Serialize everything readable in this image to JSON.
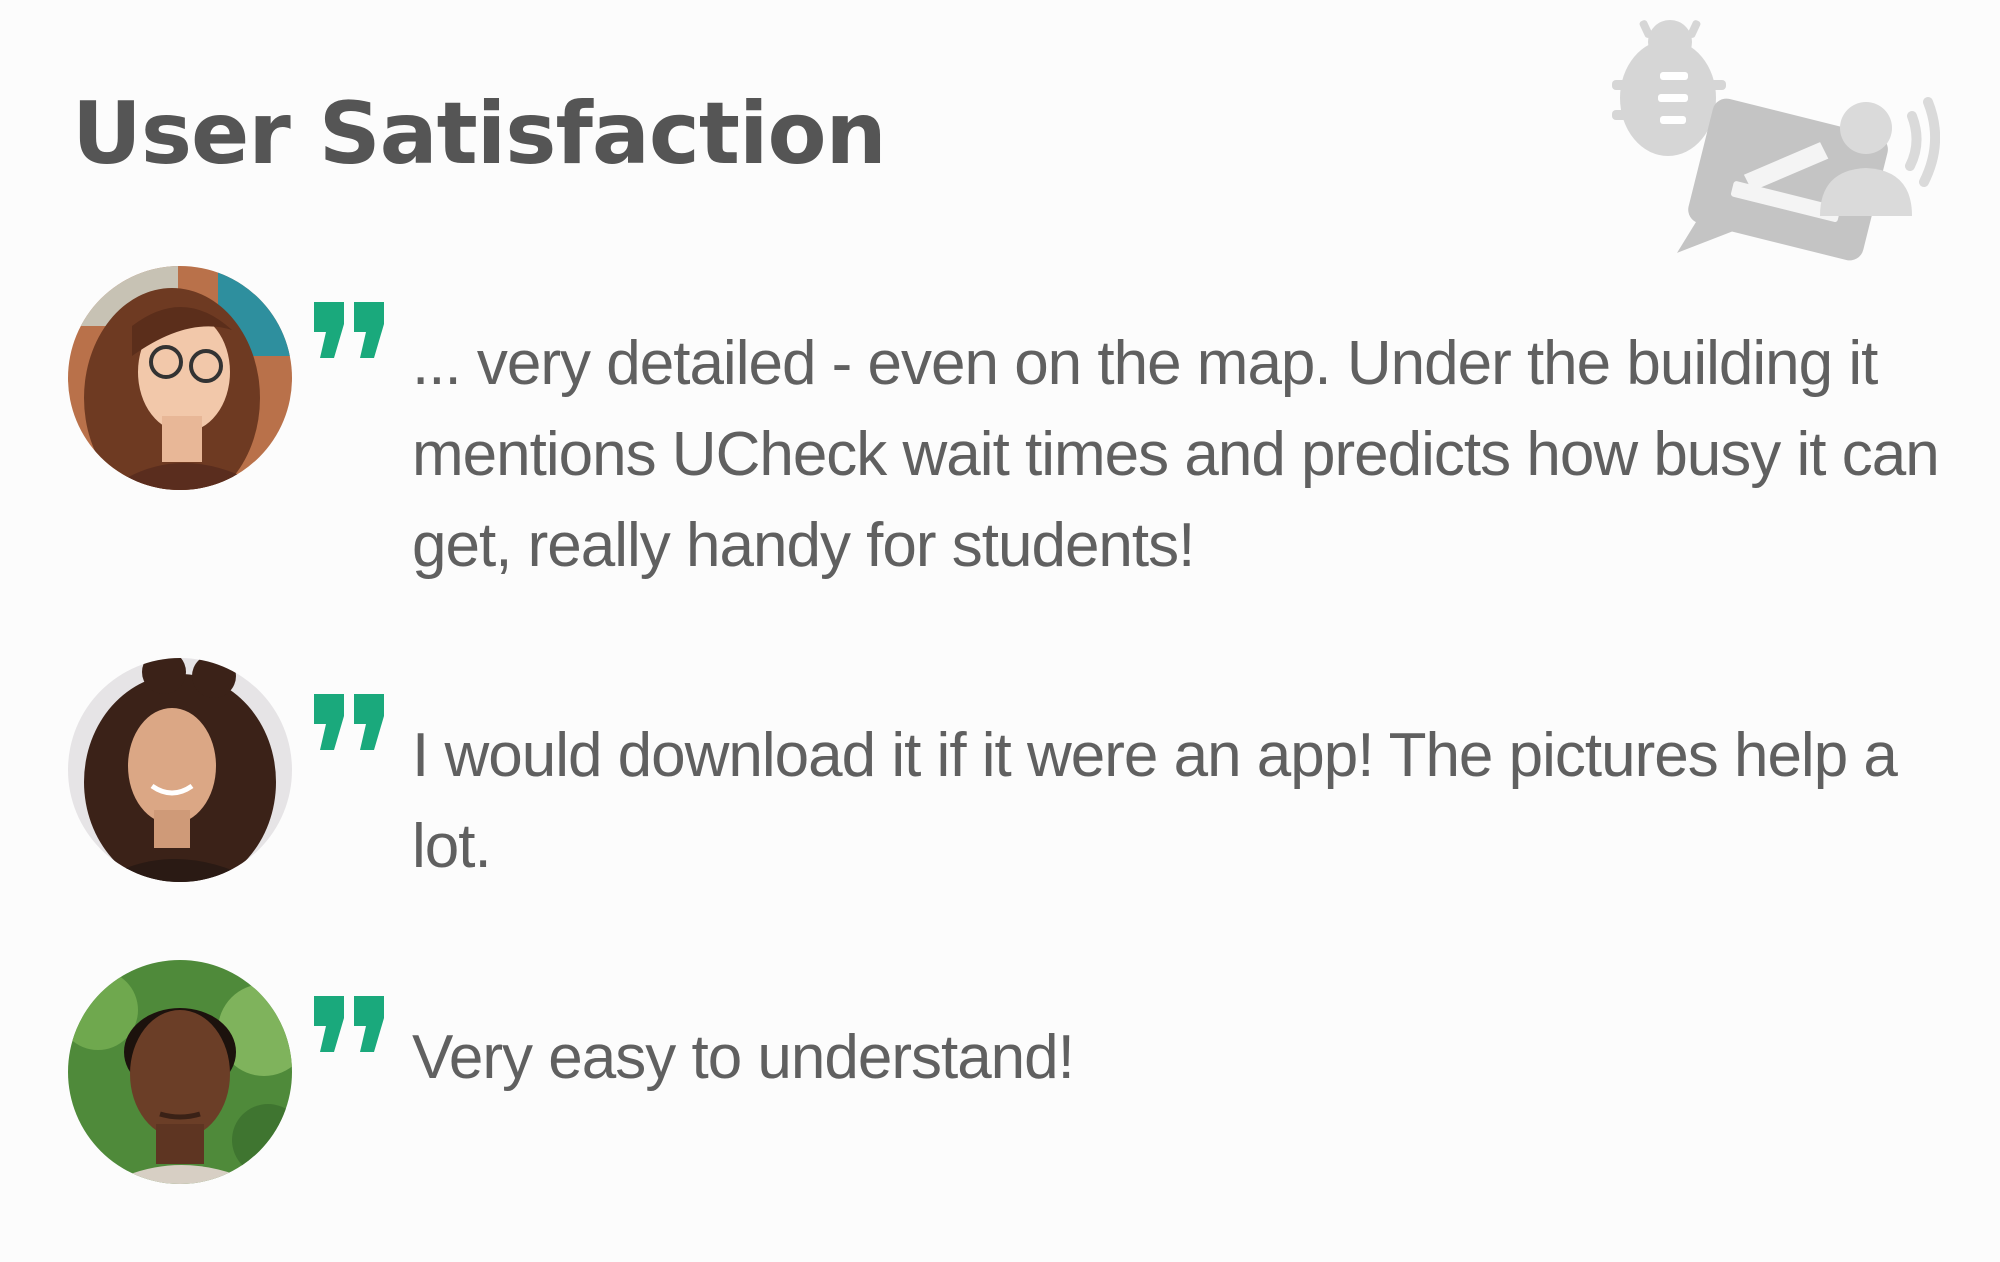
{
  "page": {
    "title": "User Satisfaction",
    "background_color": "#fcfcfc",
    "title_color": "#555555",
    "text_color": "#606060",
    "accent_color": "#1aa97c",
    "icon_color": "#c9c9c9"
  },
  "decoration": {
    "icon": "bug-feedback-chat-icon"
  },
  "testimonials": [
    {
      "quote": "... very detailed - even on the map. Under the building it mentions UCheck wait times and predicts how busy it can get, really handy for students!",
      "avatar_icon": "user-photo-avatar"
    },
    {
      "quote": "I would download it if it were an app! The pictures help a lot.",
      "avatar_icon": "user-photo-avatar"
    },
    {
      "quote": "Very easy to understand!",
      "avatar_icon": "user-photo-avatar"
    }
  ]
}
